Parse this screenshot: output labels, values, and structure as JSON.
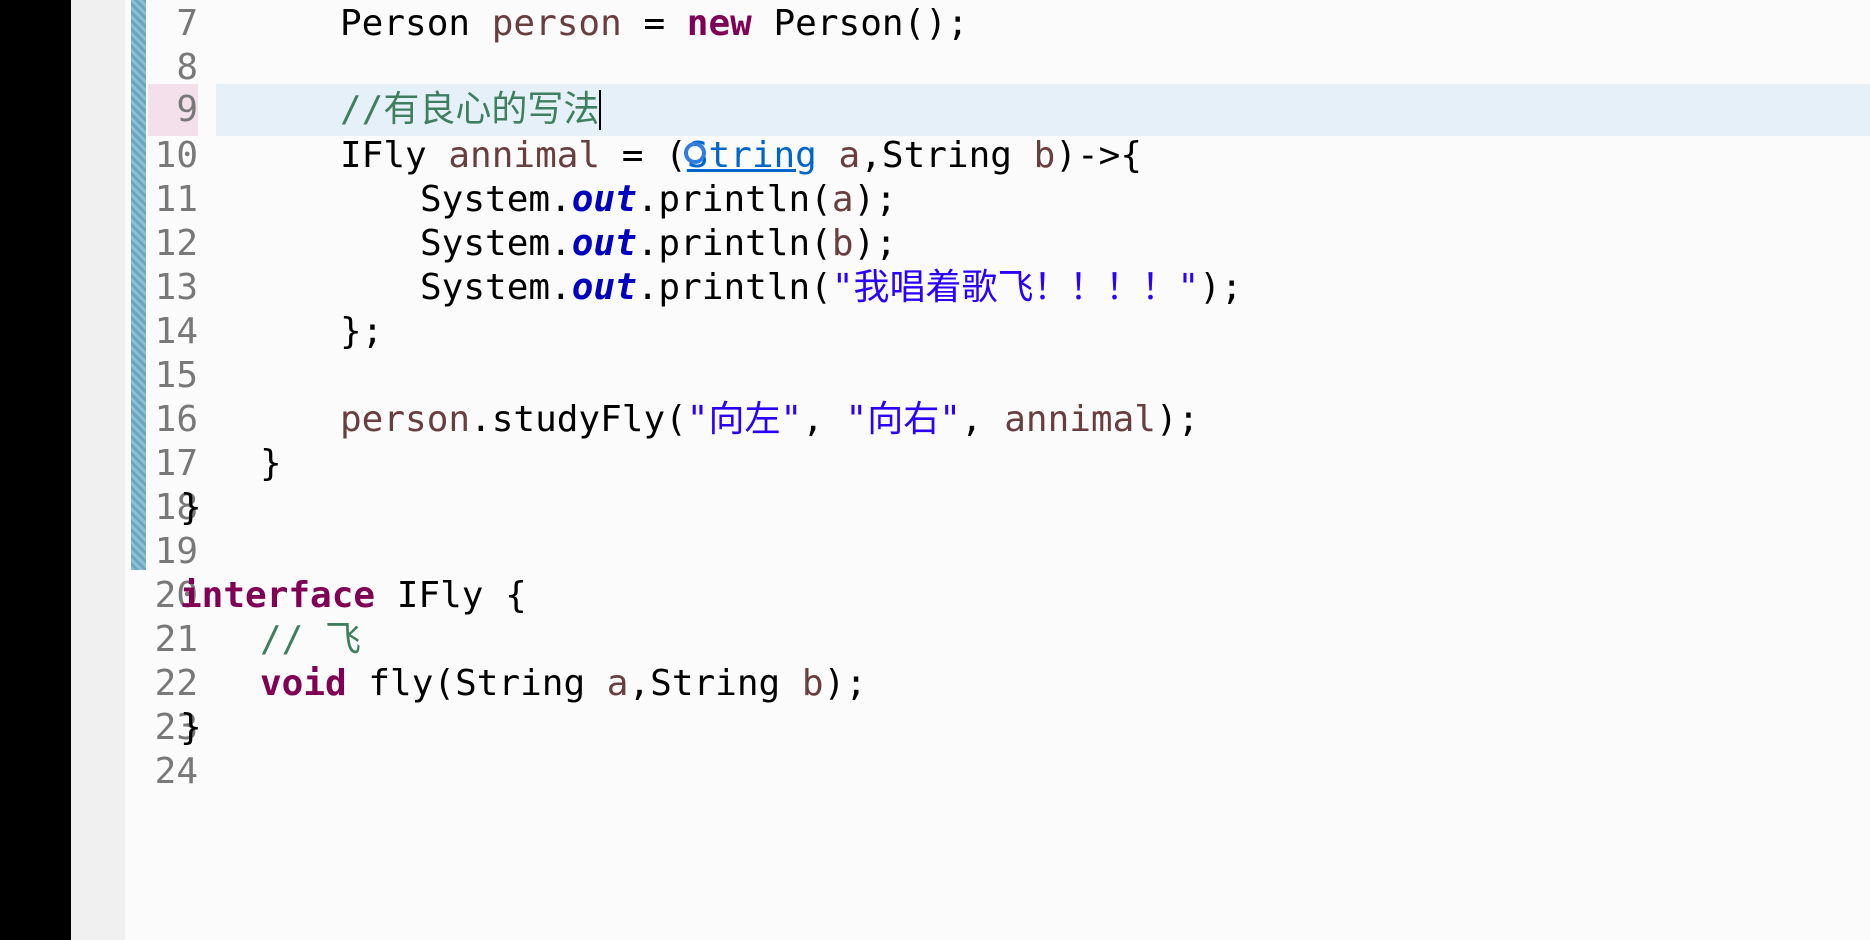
{
  "editor": {
    "colors": {
      "keyword": "#7f0055",
      "comment": "#3f7f5f",
      "string": "#2a00ff",
      "static_field": "#0000c0",
      "local_var": "#6a3e3e",
      "current_line": "#e6f0f8"
    },
    "lines": [
      {
        "no": "7",
        "t": [
          "",
          "Person ",
          "person",
          " = ",
          "new",
          " Person();"
        ]
      },
      {
        "no": "8"
      },
      {
        "no": "9",
        "comment": "//有良心的写法"
      },
      {
        "no": "10",
        "t": [
          "IFly ",
          "annimal",
          " = (",
          "String",
          " ",
          "a",
          ",String ",
          "b",
          ")->{"
        ]
      },
      {
        "no": "11",
        "t": [
          "System.",
          "out",
          ".println(",
          "a",
          ");"
        ]
      },
      {
        "no": "12",
        "t": [
          "System.",
          "out",
          ".println(",
          "b",
          ");"
        ]
      },
      {
        "no": "13",
        "t": [
          "System.",
          "out",
          ".println(",
          "\"我唱着歌飞！！！！\"",
          ");"
        ]
      },
      {
        "no": "14",
        "t": [
          "};"
        ]
      },
      {
        "no": "15"
      },
      {
        "no": "16",
        "t": [
          "person",
          ".studyFly(",
          "\"向左\"",
          ", ",
          "\"向右\"",
          ", ",
          "annimal",
          ");"
        ]
      },
      {
        "no": "17",
        "t": [
          "}"
        ]
      },
      {
        "no": "18",
        "t": [
          "}"
        ]
      },
      {
        "no": "19"
      },
      {
        "no": "20",
        "t": [
          "interface",
          " IFly {"
        ]
      },
      {
        "no": "21",
        "comment": "// 飞"
      },
      {
        "no": "22",
        "t": [
          "void",
          " fly(String ",
          "a",
          ",String ",
          "b",
          ");"
        ]
      },
      {
        "no": "23",
        "t": [
          "}"
        ]
      },
      {
        "no": "24"
      }
    ]
  }
}
